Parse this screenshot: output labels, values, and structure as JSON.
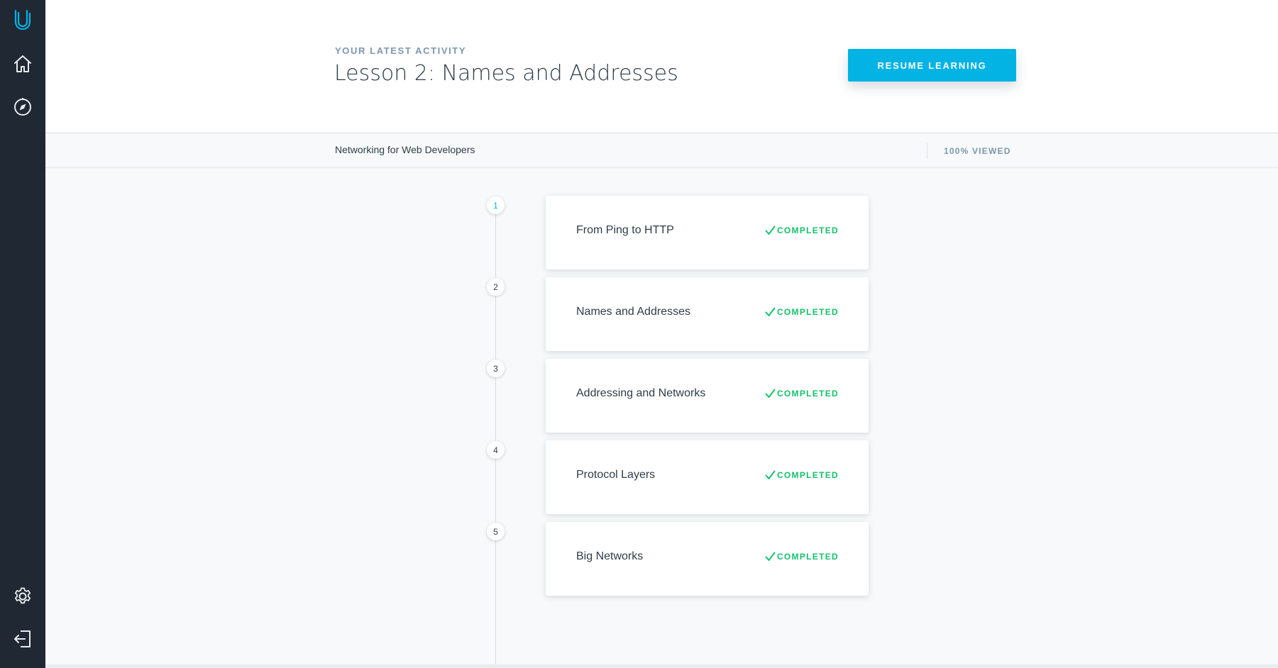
{
  "colors": {
    "sidebar": "#1f2833",
    "accent": "#02b3e4",
    "completed": "#15c26b",
    "muted": "#7d97ad",
    "text": "#2e3d49",
    "content_bg": "#f7f9fa"
  },
  "sidebar": {
    "logo_icon": "udacity-logo-icon",
    "items": [
      {
        "icon": "home-icon"
      },
      {
        "icon": "compass-icon"
      }
    ],
    "bottom_items": [
      {
        "icon": "gear-icon"
      },
      {
        "icon": "logout-icon"
      }
    ]
  },
  "header": {
    "eyebrow": "YOUR LATEST ACTIVITY",
    "title": "Lesson 2: Names and Addresses",
    "resume_label": "RESUME LEARNING"
  },
  "subbar": {
    "course_name": "Networking for Web Developers",
    "progress": "100% VIEWED"
  },
  "lessons": [
    {
      "number": "1",
      "title": "From Ping to HTTP",
      "status": "COMPLETED",
      "status_icon": "check-icon"
    },
    {
      "number": "2",
      "title": "Names and Addresses",
      "status": "COMPLETED",
      "status_icon": "check-icon"
    },
    {
      "number": "3",
      "title": "Addressing and Networks",
      "status": "COMPLETED",
      "status_icon": "check-icon"
    },
    {
      "number": "4",
      "title": "Protocol Layers",
      "status": "COMPLETED",
      "status_icon": "check-icon"
    },
    {
      "number": "5",
      "title": "Big Networks",
      "status": "COMPLETED",
      "status_icon": "check-icon"
    }
  ]
}
